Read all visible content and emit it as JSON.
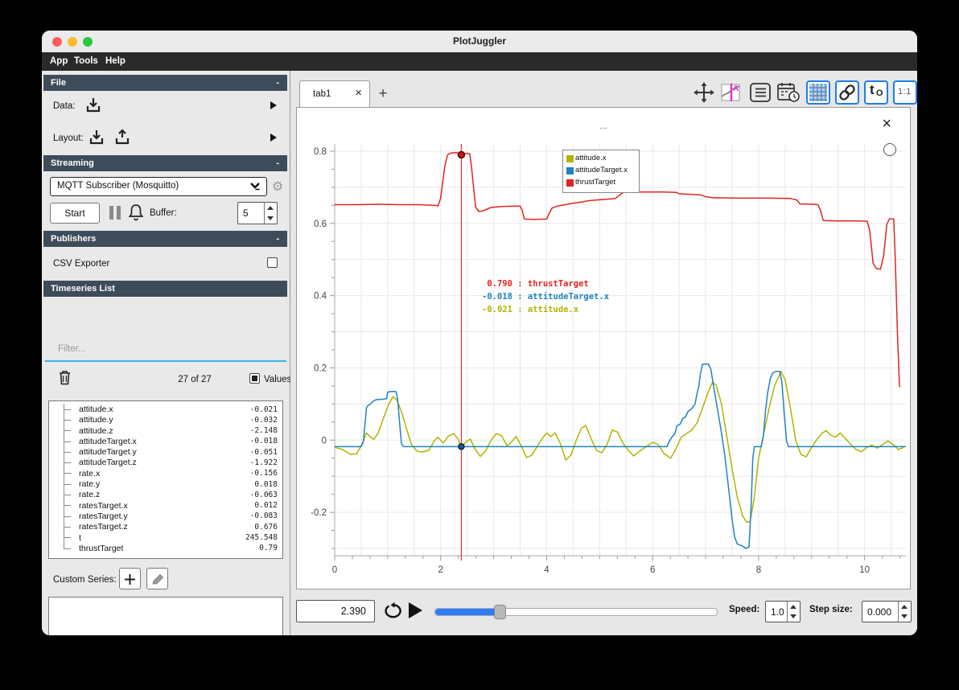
{
  "window": {
    "title": "PlotJuggler",
    "menu": [
      "App",
      "Tools",
      "Help"
    ]
  },
  "sidebar": {
    "file": {
      "header": "File",
      "collapse": "-",
      "data_label": "Data:",
      "layout_label": "Layout:"
    },
    "streaming": {
      "header": "Streaming",
      "collapse": "-",
      "source_selected": "MQTT Subscriber (Mosquitto)",
      "start_label": "Start",
      "buffer_label": "Buffer:",
      "buffer_value": "5"
    },
    "publishers": {
      "header": "Publishers",
      "collapse": "-",
      "csv_exporter_label": "CSV Exporter"
    },
    "timeseries": {
      "header": "Timeseries List",
      "filter_placeholder": "Filter...",
      "count": "27 of 27",
      "values_label": "Values",
      "items": [
        {
          "name": "attitude.x",
          "value": "-0.021"
        },
        {
          "name": "attitude.y",
          "value": "-0.032"
        },
        {
          "name": "attitude.z",
          "value": "-2.148"
        },
        {
          "name": "attitudeTarget.x",
          "value": "-0.018"
        },
        {
          "name": "attitudeTarget.y",
          "value": "-0.051"
        },
        {
          "name": "attitudeTarget.z",
          "value": "-1.922"
        },
        {
          "name": "rate.x",
          "value": "-0.156"
        },
        {
          "name": "rate.y",
          "value": "0.018"
        },
        {
          "name": "rate.z",
          "value": "-0.063"
        },
        {
          "name": "ratesTarget.x",
          "value": "0.012"
        },
        {
          "name": "ratesTarget.y",
          "value": "-0.083"
        },
        {
          "name": "ratesTarget.z",
          "value": "0.676"
        },
        {
          "name": "t",
          "value": "245.548"
        },
        {
          "name": "thrustTarget",
          "value": "0.79"
        }
      ]
    },
    "custom_series": {
      "label": "Custom Series:"
    }
  },
  "tabbar": {
    "active_tab": "tab1",
    "add_tab": "+"
  },
  "toolbar": {
    "t0_main": "t",
    "t0_sub": "O",
    "ratio_label": "1:1",
    "accent": "#1f7fe8"
  },
  "plot": {
    "title": "..."
  },
  "playback": {
    "time": "2.390",
    "speed_label": "Speed:",
    "speed_value": "1.0",
    "step_label": "Step size:",
    "step_value": "0.000"
  },
  "chart_data": {
    "type": "line",
    "title": "...",
    "xlabel": "",
    "ylabel": "",
    "xlim": [
      0,
      10.78
    ],
    "ylim": [
      -0.32,
      0.82
    ],
    "x_ticks": [
      0,
      2,
      4,
      6,
      8,
      10
    ],
    "y_ticks": [
      -0.2,
      0,
      0.2,
      0.4,
      0.6,
      0.8
    ],
    "grid": "on",
    "legend_position": "top-right",
    "cursor": {
      "x": 2.39,
      "readout": [
        {
          "value": "0.790",
          "series": "thrustTarget"
        },
        {
          "value": "-0.018",
          "series": "attitudeTarget.x"
        },
        {
          "value": "-0.021",
          "series": "attitude.x"
        }
      ]
    },
    "series": [
      {
        "name": "attitude.x",
        "color": "#b3b300",
        "points": [
          [
            0,
            -0.02
          ],
          [
            0.15,
            -0.026
          ],
          [
            0.3,
            -0.04
          ],
          [
            0.42,
            -0.037
          ],
          [
            0.52,
            -0.01
          ],
          [
            0.6,
            0.02
          ],
          [
            0.68,
            0.008
          ],
          [
            0.74,
            0.002
          ],
          [
            0.82,
            0.02
          ],
          [
            0.92,
            0.06
          ],
          [
            1.02,
            0.1
          ],
          [
            1.1,
            0.12
          ],
          [
            1.17,
            0.112
          ],
          [
            1.27,
            0.075
          ],
          [
            1.37,
            0.025
          ],
          [
            1.45,
            -0.012
          ],
          [
            1.55,
            -0.03
          ],
          [
            1.65,
            -0.033
          ],
          [
            1.78,
            -0.028
          ],
          [
            1.88,
            -0.002
          ],
          [
            1.95,
            0.008
          ],
          [
            2.05,
            -0.008
          ],
          [
            2.15,
            0.012
          ],
          [
            2.25,
            0.018
          ],
          [
            2.33,
            0.002
          ],
          [
            2.39,
            -0.021
          ],
          [
            2.48,
            -0.005
          ],
          [
            2.56,
            0.003
          ],
          [
            2.65,
            -0.025
          ],
          [
            2.75,
            -0.045
          ],
          [
            2.85,
            -0.03
          ],
          [
            2.95,
            0
          ],
          [
            3.05,
            0.018
          ],
          [
            3.15,
            0.012
          ],
          [
            3.25,
            -0.015
          ],
          [
            3.32,
            -0.008
          ],
          [
            3.42,
            0.01
          ],
          [
            3.52,
            -0.015
          ],
          [
            3.62,
            -0.048
          ],
          [
            3.72,
            -0.042
          ],
          [
            3.82,
            -0.018
          ],
          [
            3.92,
            0.005
          ],
          [
            4,
            0.02
          ],
          [
            4.08,
            0.01
          ],
          [
            4.16,
            0.02
          ],
          [
            4.26,
            -0.01
          ],
          [
            4.36,
            -0.055
          ],
          [
            4.46,
            -0.042
          ],
          [
            4.56,
            0
          ],
          [
            4.66,
            0.034
          ],
          [
            4.74,
            0.04
          ],
          [
            4.84,
            0.004
          ],
          [
            4.94,
            -0.028
          ],
          [
            5.04,
            -0.035
          ],
          [
            5.14,
            -0.012
          ],
          [
            5.24,
            0.028
          ],
          [
            5.34,
            0.022
          ],
          [
            5.44,
            -0.008
          ],
          [
            5.54,
            -0.028
          ],
          [
            5.64,
            -0.044
          ],
          [
            5.76,
            -0.03
          ],
          [
            5.88,
            -0.018
          ],
          [
            6,
            -0.006
          ],
          [
            6.1,
            -0.012
          ],
          [
            6.22,
            -0.038
          ],
          [
            6.34,
            -0.05
          ],
          [
            6.44,
            -0.024
          ],
          [
            6.54,
            0.008
          ],
          [
            6.64,
            0.018
          ],
          [
            6.74,
            0.028
          ],
          [
            6.84,
            0.048
          ],
          [
            6.94,
            0.088
          ],
          [
            7.04,
            0.13
          ],
          [
            7.13,
            0.16
          ],
          [
            7.2,
            0.152
          ],
          [
            7.3,
            0.1
          ],
          [
            7.4,
            0.01
          ],
          [
            7.5,
            -0.08
          ],
          [
            7.6,
            -0.16
          ],
          [
            7.7,
            -0.21
          ],
          [
            7.78,
            -0.228
          ],
          [
            7.84,
            -0.225
          ],
          [
            7.92,
            -0.16
          ],
          [
            8,
            -0.05
          ],
          [
            8.1,
            0.02
          ],
          [
            8.2,
            0.09
          ],
          [
            8.3,
            0.15
          ],
          [
            8.42,
            0.19
          ],
          [
            8.5,
            0.168
          ],
          [
            8.6,
            0.09
          ],
          [
            8.7,
            0
          ],
          [
            8.8,
            -0.04
          ],
          [
            8.9,
            -0.046
          ],
          [
            9,
            -0.02
          ],
          [
            9.1,
            0.002
          ],
          [
            9.2,
            0.02
          ],
          [
            9.28,
            0.026
          ],
          [
            9.36,
            0.014
          ],
          [
            9.45,
            0.008
          ],
          [
            9.54,
            0.02
          ],
          [
            9.64,
            0.004
          ],
          [
            9.74,
            -0.012
          ],
          [
            9.84,
            -0.026
          ],
          [
            9.94,
            -0.032
          ],
          [
            10.04,
            -0.02
          ],
          [
            10.14,
            -0.014
          ],
          [
            10.24,
            -0.022
          ],
          [
            10.34,
            -0.012
          ],
          [
            10.44,
            -0.002
          ],
          [
            10.54,
            -0.012
          ],
          [
            10.64,
            -0.026
          ],
          [
            10.74,
            -0.02
          ]
        ]
      },
      {
        "name": "attitudeTarget.x",
        "color": "#1f83c0",
        "points": [
          [
            0,
            -0.018
          ],
          [
            0.5,
            -0.018
          ],
          [
            0.54,
            -0.005
          ],
          [
            0.57,
            0.04
          ],
          [
            0.6,
            0.09
          ],
          [
            0.63,
            0.096
          ],
          [
            0.68,
            0.1
          ],
          [
            0.72,
            0.107
          ],
          [
            0.78,
            0.112
          ],
          [
            0.9,
            0.113
          ],
          [
            0.98,
            0.115
          ],
          [
            1,
            0.133
          ],
          [
            1.1,
            0.135
          ],
          [
            1.16,
            0.134
          ],
          [
            1.19,
            0.11
          ],
          [
            1.23,
            0.04
          ],
          [
            1.26,
            -0.01
          ],
          [
            1.3,
            -0.018
          ],
          [
            2.5,
            -0.018
          ],
          [
            4,
            -0.018
          ],
          [
            5.5,
            -0.018
          ],
          [
            6.27,
            -0.018
          ],
          [
            6.3,
            -0.008
          ],
          [
            6.36,
            0.008
          ],
          [
            6.42,
            0.018
          ],
          [
            6.46,
            0.04
          ],
          [
            6.52,
            0.044
          ],
          [
            6.57,
            0.06
          ],
          [
            6.62,
            0.064
          ],
          [
            6.67,
            0.08
          ],
          [
            6.73,
            0.086
          ],
          [
            6.8,
            0.1
          ],
          [
            6.84,
            0.13
          ],
          [
            6.87,
            0.148
          ],
          [
            6.9,
            0.182
          ],
          [
            6.94,
            0.21
          ],
          [
            7.05,
            0.211
          ],
          [
            7.1,
            0.196
          ],
          [
            7.16,
            0.14
          ],
          [
            7.22,
            0.09
          ],
          [
            7.3,
            0.02
          ],
          [
            7.36,
            -0.04
          ],
          [
            7.44,
            -0.14
          ],
          [
            7.5,
            -0.22
          ],
          [
            7.55,
            -0.27
          ],
          [
            7.6,
            -0.288
          ],
          [
            7.7,
            -0.293
          ],
          [
            7.76,
            -0.3
          ],
          [
            7.82,
            -0.295
          ],
          [
            7.86,
            -0.18
          ],
          [
            7.89,
            -0.05
          ],
          [
            7.92,
            -0.018
          ],
          [
            8.05,
            -0.018
          ],
          [
            8.09,
            0.01
          ],
          [
            8.13,
            0.08
          ],
          [
            8.17,
            0.13
          ],
          [
            8.22,
            0.17
          ],
          [
            8.27,
            0.186
          ],
          [
            8.33,
            0.19
          ],
          [
            8.4,
            0.19
          ],
          [
            8.44,
            0.16
          ],
          [
            8.48,
            0.08
          ],
          [
            8.53,
            -0.005
          ],
          [
            8.57,
            -0.018
          ],
          [
            9.5,
            -0.018
          ],
          [
            10.78,
            -0.018
          ]
        ]
      },
      {
        "name": "thrustTarget",
        "color": "#e02420",
        "points": [
          [
            0,
            0.652
          ],
          [
            0.4,
            0.652
          ],
          [
            0.8,
            0.653
          ],
          [
            1.2,
            0.652
          ],
          [
            1.6,
            0.652
          ],
          [
            1.9,
            0.65
          ],
          [
            1.95,
            0.648
          ],
          [
            2,
            0.67
          ],
          [
            2.08,
            0.76
          ],
          [
            2.13,
            0.79
          ],
          [
            2.2,
            0.795
          ],
          [
            2.3,
            0.796
          ],
          [
            2.39,
            0.79
          ],
          [
            2.48,
            0.794
          ],
          [
            2.55,
            0.793
          ],
          [
            2.58,
            0.76
          ],
          [
            2.62,
            0.7
          ],
          [
            2.66,
            0.645
          ],
          [
            2.72,
            0.633
          ],
          [
            2.8,
            0.635
          ],
          [
            2.95,
            0.644
          ],
          [
            3.15,
            0.647
          ],
          [
            3.5,
            0.648
          ],
          [
            3.54,
            0.635
          ],
          [
            3.58,
            0.612
          ],
          [
            3.75,
            0.611
          ],
          [
            4,
            0.612
          ],
          [
            4.04,
            0.625
          ],
          [
            4.1,
            0.642
          ],
          [
            4.2,
            0.648
          ],
          [
            4.35,
            0.652
          ],
          [
            4.5,
            0.656
          ],
          [
            4.65,
            0.659
          ],
          [
            4.8,
            0.663
          ],
          [
            4.95,
            0.665
          ],
          [
            5.15,
            0.667
          ],
          [
            5.3,
            0.669
          ],
          [
            5.38,
            0.679
          ],
          [
            5.45,
            0.686
          ],
          [
            5.8,
            0.687
          ],
          [
            6.2,
            0.687
          ],
          [
            6.45,
            0.686
          ],
          [
            6.5,
            0.682
          ],
          [
            6.9,
            0.679
          ],
          [
            7,
            0.674
          ],
          [
            7.15,
            0.671
          ],
          [
            7.6,
            0.67
          ],
          [
            8.2,
            0.67
          ],
          [
            8.6,
            0.669
          ],
          [
            8.72,
            0.665
          ],
          [
            8.78,
            0.654
          ],
          [
            9,
            0.653
          ],
          [
            9.12,
            0.652
          ],
          [
            9.17,
            0.635
          ],
          [
            9.22,
            0.608
          ],
          [
            9.5,
            0.607
          ],
          [
            9.9,
            0.607
          ],
          [
            10.05,
            0.606
          ],
          [
            10.1,
            0.578
          ],
          [
            10.16,
            0.49
          ],
          [
            10.22,
            0.475
          ],
          [
            10.3,
            0.473
          ],
          [
            10.36,
            0.51
          ],
          [
            10.42,
            0.597
          ],
          [
            10.47,
            0.613
          ],
          [
            10.55,
            0.612
          ],
          [
            10.58,
            0.5
          ],
          [
            10.62,
            0.294
          ],
          [
            10.66,
            0.147
          ]
        ]
      }
    ]
  }
}
